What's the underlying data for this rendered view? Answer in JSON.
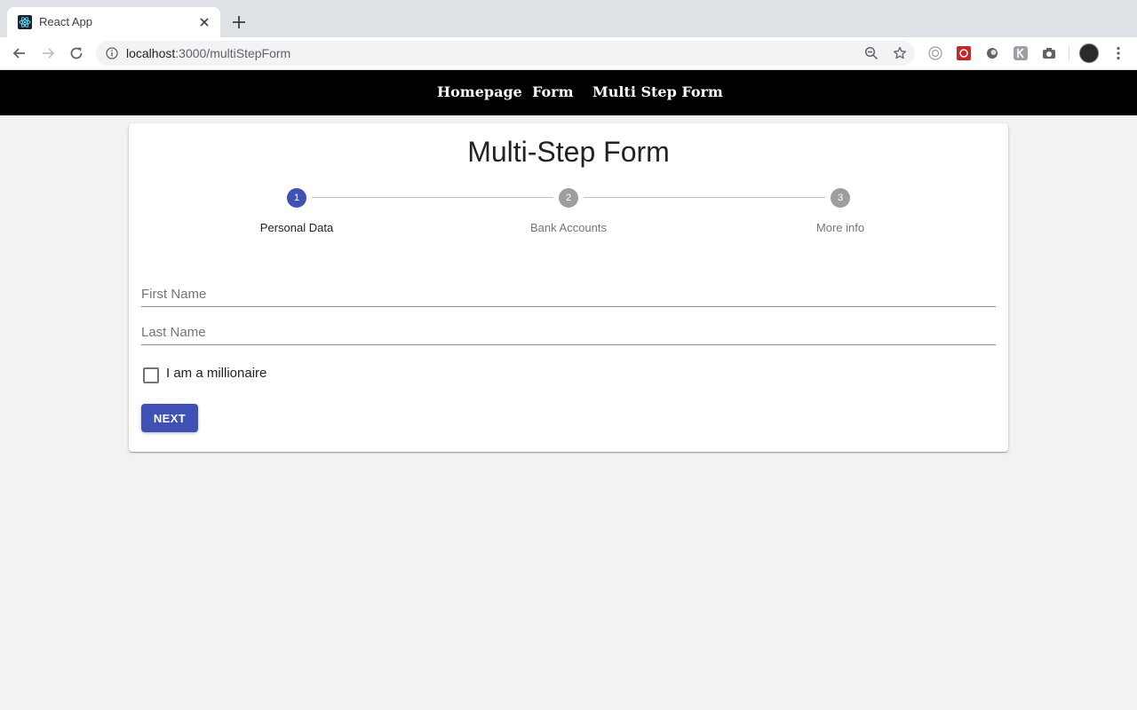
{
  "browser": {
    "tab_title": "React App",
    "url_host": "localhost",
    "url_path": ":3000/multiStepForm"
  },
  "nav": {
    "links": [
      "Homepage",
      "Form",
      "Multi Step Form"
    ]
  },
  "form": {
    "title": "Multi-Step Form",
    "active_step": 1,
    "steps": [
      {
        "number": "1",
        "label": "Personal Data"
      },
      {
        "number": "2",
        "label": "Bank Accounts"
      },
      {
        "number": "3",
        "label": "More info"
      }
    ],
    "first_name": {
      "placeholder": "First Name",
      "value": ""
    },
    "last_name": {
      "placeholder": "Last Name",
      "value": ""
    },
    "millionaire_label": "I am a millionaire",
    "millionaire_checked": false,
    "next_label": "NEXT"
  },
  "colors": {
    "accent": "#3f51b5",
    "inactive_step": "#9e9e9e",
    "nav_background": "#000000",
    "page_background": "#f2f2f2"
  }
}
